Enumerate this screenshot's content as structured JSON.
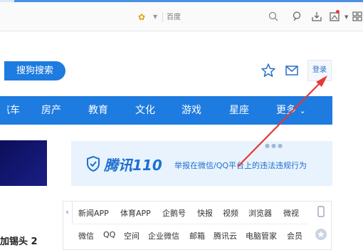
{
  "toolbar": {
    "engine_icon": "bee-icon",
    "search_placeholder": "百度",
    "icons": [
      "search-icon",
      "reader-icon",
      "download-icon",
      "screenshot-icon",
      "grid-icon"
    ]
  },
  "header": {
    "sogou_button": "搜狗搜索",
    "login": "登录"
  },
  "nav": {
    "items": [
      "汽车",
      "房产",
      "教育",
      "文化",
      "游戏",
      "星座",
      "更多"
    ]
  },
  "banner": {
    "title": "腾讯110",
    "subtitle": "举报在微信/QQ平台上的违法违规行为"
  },
  "links": {
    "row1": [
      "新闻APP",
      "体育APP",
      "企鹅号",
      "快报",
      "视频",
      "浏览器",
      "微视"
    ],
    "row2": [
      "微信",
      "QQ",
      "空间",
      "企业微信",
      "邮箱",
      "腾讯云",
      "电脑管家",
      "会员"
    ]
  },
  "content": {
    "cut_headline": "加锡头 2"
  },
  "colors": {
    "brand_blue": "#1e7be0",
    "annotation_red": "#e53935"
  }
}
